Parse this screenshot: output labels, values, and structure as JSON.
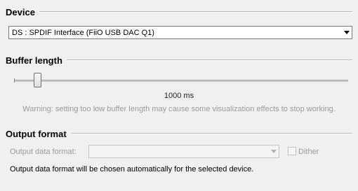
{
  "device": {
    "title": "Device",
    "selected": "DS : SPDIF Interface (FiiO USB DAC Q1)"
  },
  "buffer": {
    "title": "Buffer length",
    "value_label": "1000 ms",
    "slider_fraction": 0.04,
    "warning": "Warning: setting too low buffer length may cause some visualization effects to stop working."
  },
  "output": {
    "title": "Output format",
    "data_format_label": "Output data format:",
    "data_format_value": "",
    "dither_label": "Dither",
    "dither_checked": false,
    "info": "Output data format will be chosen automatically for the selected device."
  }
}
